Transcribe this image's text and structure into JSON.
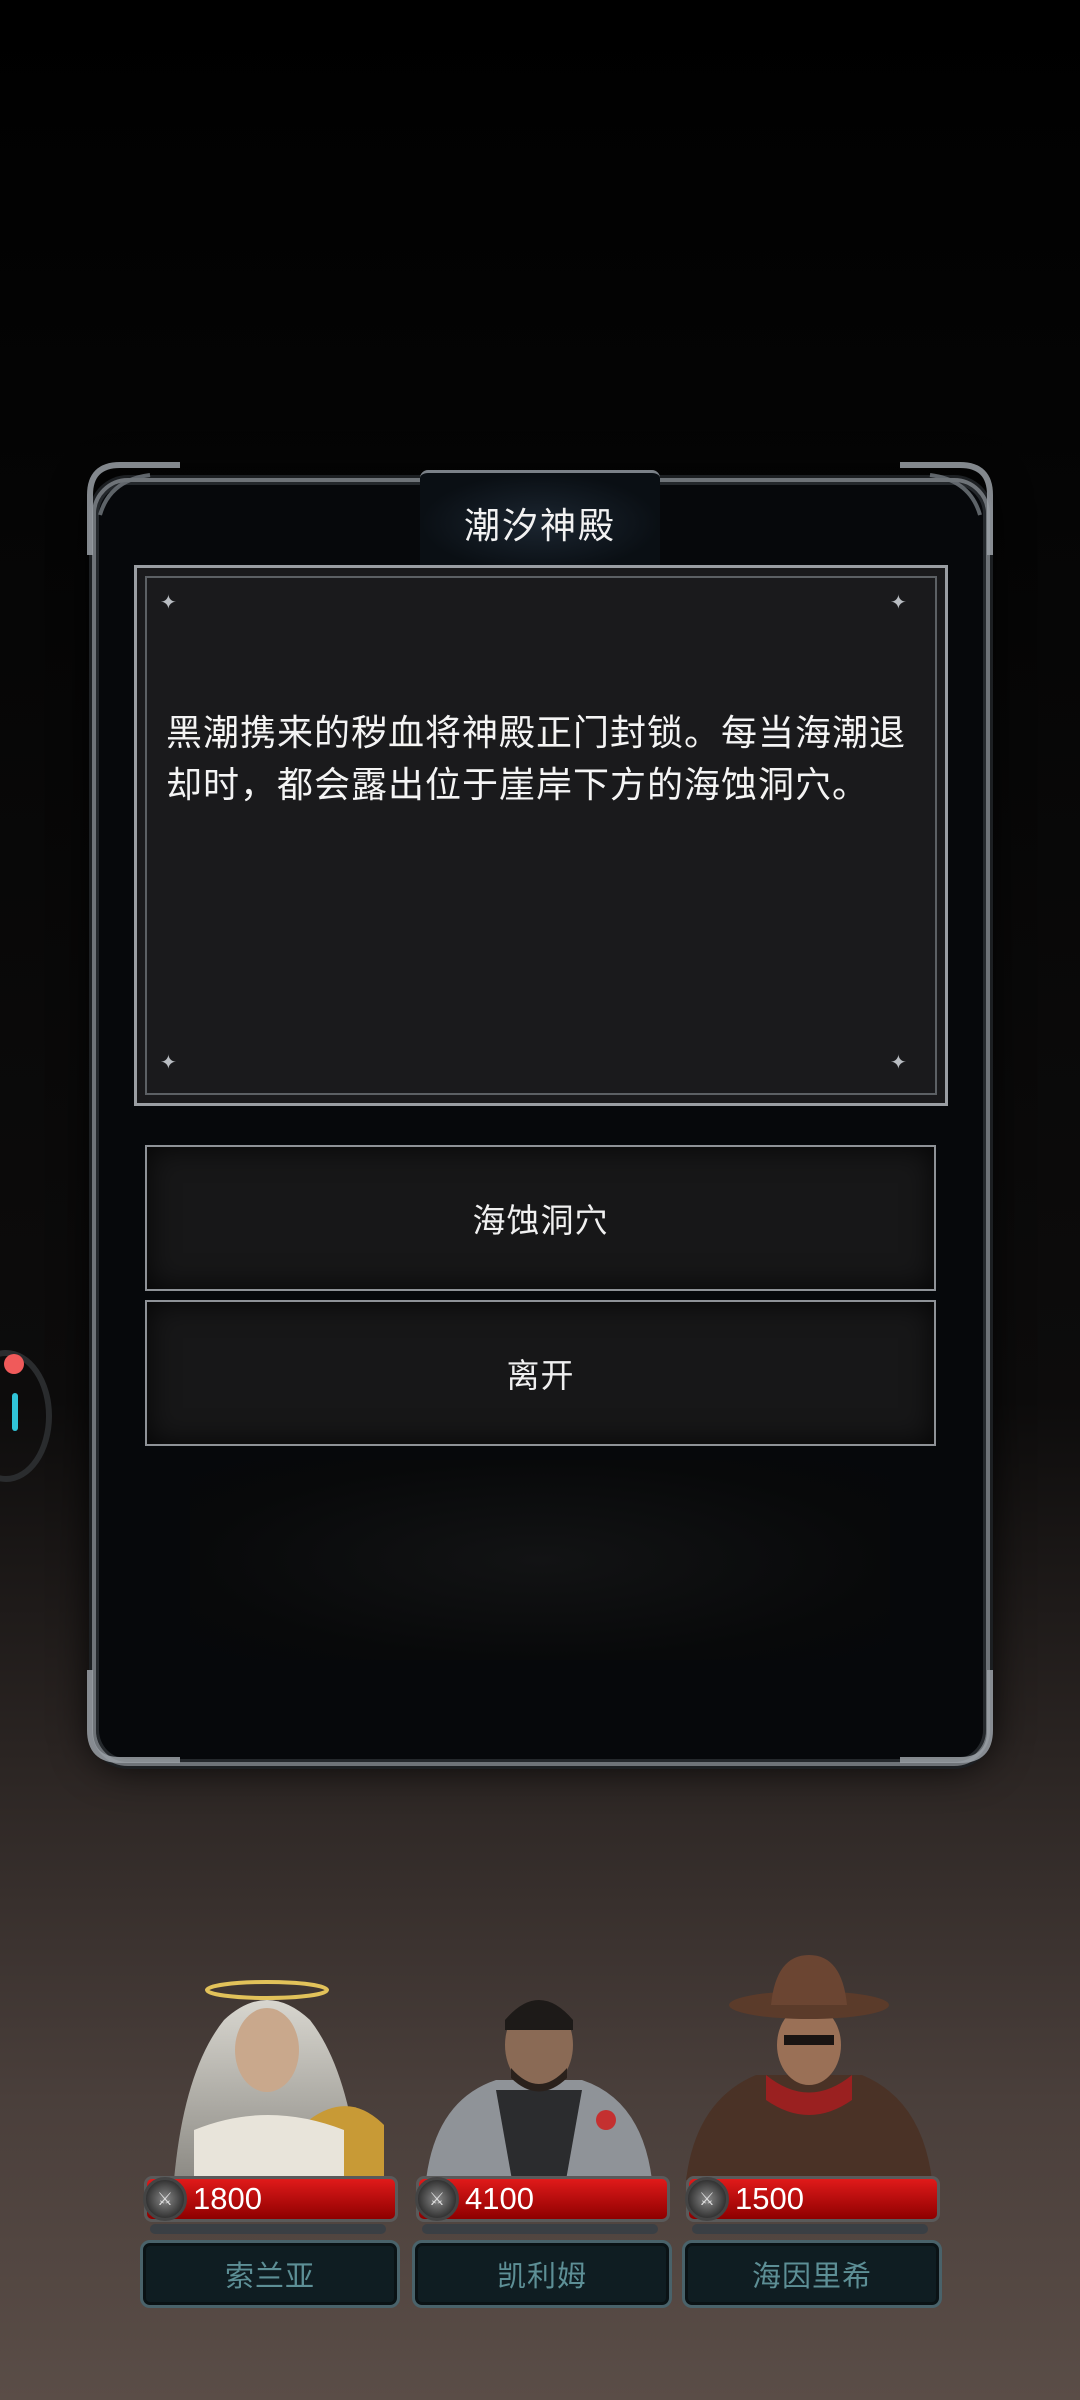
{
  "event": {
    "title": "潮汐神殿",
    "description": "黑潮携来的秽血将神殿正门封锁。每当海潮退却时，都会露出位于崖岸下方的海蚀洞穴。",
    "choices": [
      "海蚀洞穴",
      "离开"
    ]
  },
  "party": [
    {
      "name": "索兰亚",
      "hp": "1800",
      "hp_fraction": 1.0
    },
    {
      "name": "凯利姆",
      "hp": "4100",
      "hp_fraction": 1.0
    },
    {
      "name": "海因里希",
      "hp": "1500",
      "hp_fraction": 1.0
    }
  ],
  "icons": {
    "hp_icon": "blade-icon",
    "side_widget": "floating-assistant-icon"
  },
  "colors": {
    "hp_bar": "#d01010",
    "name_text": "#5d8f96",
    "frame": "#6e7378"
  }
}
